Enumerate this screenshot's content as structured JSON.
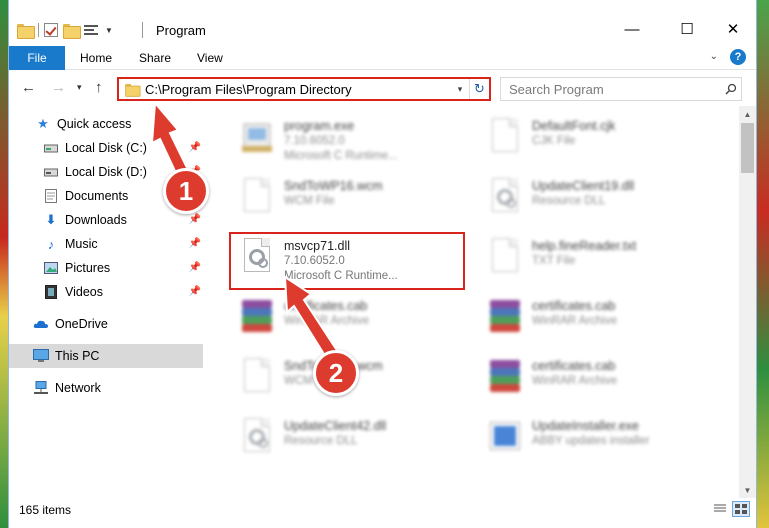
{
  "window": {
    "title": "Program",
    "controls": {
      "minimize": "—",
      "maximize": "☐",
      "close": "✕"
    }
  },
  "ribbon": {
    "tabs": [
      {
        "label": "File"
      },
      {
        "label": "Home"
      },
      {
        "label": "Share"
      },
      {
        "label": "View"
      }
    ],
    "help": "?"
  },
  "navigation": {
    "address": "C:\\Program Files\\Program Directory",
    "search_placeholder": "Search Program"
  },
  "sidebar": {
    "items": [
      {
        "label": "Quick access",
        "icon": "star-icon"
      },
      {
        "label": "Local Disk (C:)",
        "icon": "drive-icon",
        "pinned": true
      },
      {
        "label": "Local Disk (D:)",
        "icon": "drive-icon",
        "pinned": true
      },
      {
        "label": "Documents",
        "icon": "documents-icon",
        "pinned": true
      },
      {
        "label": "Downloads",
        "icon": "download-icon",
        "pinned": true
      },
      {
        "label": "Music",
        "icon": "music-icon",
        "pinned": true
      },
      {
        "label": "Pictures",
        "icon": "pictures-icon",
        "pinned": true
      },
      {
        "label": "Videos",
        "icon": "videos-icon",
        "pinned": true
      },
      {
        "label": "OneDrive",
        "icon": "cloud-icon"
      },
      {
        "label": "This PC",
        "icon": "computer-icon",
        "selected": true
      },
      {
        "label": "Network",
        "icon": "network-icon"
      }
    ]
  },
  "files": [
    {
      "name": "program.exe",
      "line1": "7.10.6052.0",
      "line2": "Microsoft C Runtime...",
      "icon": "program-exe-icon"
    },
    {
      "name": "DefaultFont.cjk",
      "line1": "CJK File",
      "line2": "",
      "icon": "document-icon"
    },
    {
      "name": "SndToWP16.wcm",
      "line1": "WCM File",
      "line2": "",
      "icon": "document-icon"
    },
    {
      "name": "UpdateClient19.dll",
      "line1": "Resource DLL",
      "line2": "",
      "icon": "dll-icon"
    },
    {
      "name": "msvcp71.dll",
      "line1": "7.10.6052.0",
      "line2": "Microsoft C Runtime...",
      "icon": "dll-icon",
      "highlighted": true
    },
    {
      "name": "help.fineReader.txt",
      "line1": "TXT File",
      "line2": "",
      "icon": "document-icon"
    },
    {
      "name": "certificates.cab",
      "line1": "WinRAR Archive",
      "line2": "",
      "icon": "winrar-icon"
    },
    {
      "name": "certificates.cab",
      "line1": "WinRAR Archive",
      "line2": "",
      "icon": "winrar-icon"
    },
    {
      "name": "SndToWP16.wcm",
      "line1": "WCM File",
      "line2": "",
      "icon": "document-icon"
    },
    {
      "name": "certificates.cab",
      "line1": "WinRAR Archive",
      "line2": "",
      "icon": "winrar-icon"
    },
    {
      "name": "UpdateClient42.dll",
      "line1": "Resource DLL",
      "line2": "",
      "icon": "dll-icon"
    },
    {
      "name": "UpdateInstaller.exe",
      "line1": "ABBY updates installer",
      "line2": "",
      "icon": "installer-icon"
    }
  ],
  "status": {
    "items_count": "165 items"
  },
  "callouts": [
    {
      "label": "1"
    },
    {
      "label": "2"
    }
  ],
  "colors": {
    "accent": "#1979ca",
    "highlight": "#d9241c",
    "badge": "#de3b2f"
  }
}
